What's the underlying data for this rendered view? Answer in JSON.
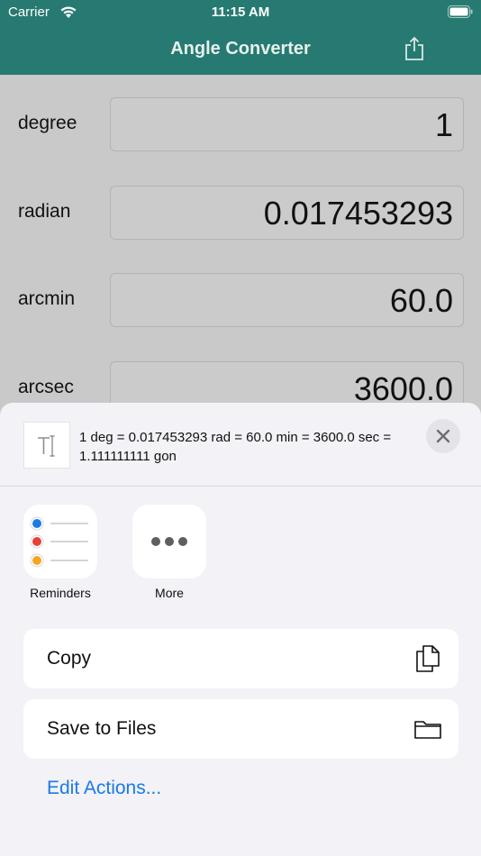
{
  "status_bar": {
    "carrier": "Carrier",
    "time": "11:15 AM"
  },
  "nav": {
    "title": "Angle Converter",
    "share_icon": "share-icon"
  },
  "rows": [
    {
      "label": "degree",
      "value": "1"
    },
    {
      "label": "radian",
      "value": "0.017453293"
    },
    {
      "label": "arcmin",
      "value": "60.0"
    },
    {
      "label": "arcsec",
      "value": "3600.0"
    }
  ],
  "share_sheet": {
    "preview_text": "1 deg = 0.017453293 rad = 60.0 min = 3600.0 sec = 1.111111111 gon",
    "apps": [
      {
        "label": "Reminders",
        "icon": "reminders-icon"
      },
      {
        "label": "More",
        "icon": "more-icon"
      }
    ],
    "actions": [
      {
        "label": "Copy",
        "icon": "copy-icon"
      },
      {
        "label": "Save to Files",
        "icon": "folder-icon"
      }
    ],
    "edit_actions_label": "Edit Actions..."
  },
  "colors": {
    "nav_bg": "#267a71",
    "link": "#1a7ae6"
  }
}
